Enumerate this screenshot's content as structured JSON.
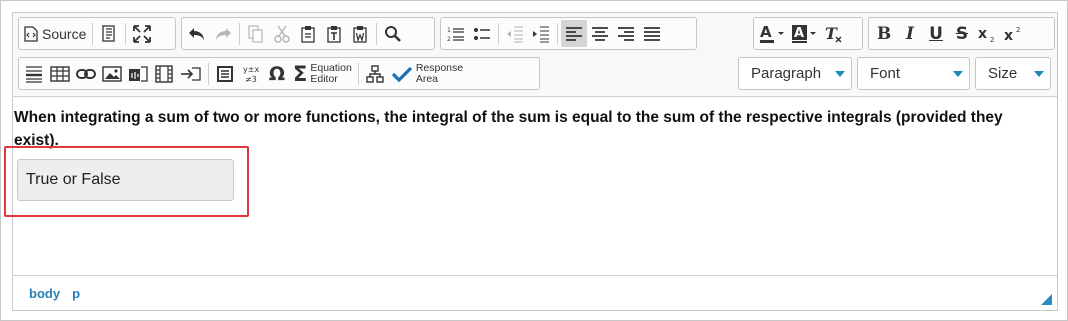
{
  "toolbar": {
    "source_label": "Source",
    "equation_editor_label_1": "Equation",
    "equation_editor_label_2": "Editor",
    "response_area_label_1": "Response",
    "response_area_label_2": "Area",
    "format_dropdown": "Paragraph",
    "font_dropdown": "Font",
    "size_dropdown": "Size"
  },
  "content": {
    "paragraph": "When integrating a sum of two or more functions, the integral of the sum is equal to the sum of the respective integrals (provided they exist).",
    "response_area_text": "True or False"
  },
  "statusbar": {
    "path": [
      "body",
      "p"
    ]
  },
  "colors": {
    "accent": "#2b8ec2",
    "highlight": "#e0383e",
    "check": "#1a6fb0"
  }
}
